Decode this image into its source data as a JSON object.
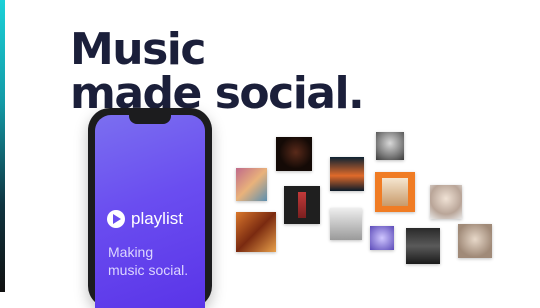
{
  "headline": {
    "line1": "Music",
    "line2": "made social."
  },
  "phone": {
    "app_name": "playlist",
    "app_icon": "play-icon",
    "tagline_line1": "Making",
    "tagline_line2": "music social."
  },
  "colors": {
    "headline": "#1b1f3a",
    "phone_gradient_start": "#7b6ff0",
    "phone_gradient_end": "#5a34e8",
    "accent_strip": "#1bd1d8"
  },
  "album_covers_count": 12
}
